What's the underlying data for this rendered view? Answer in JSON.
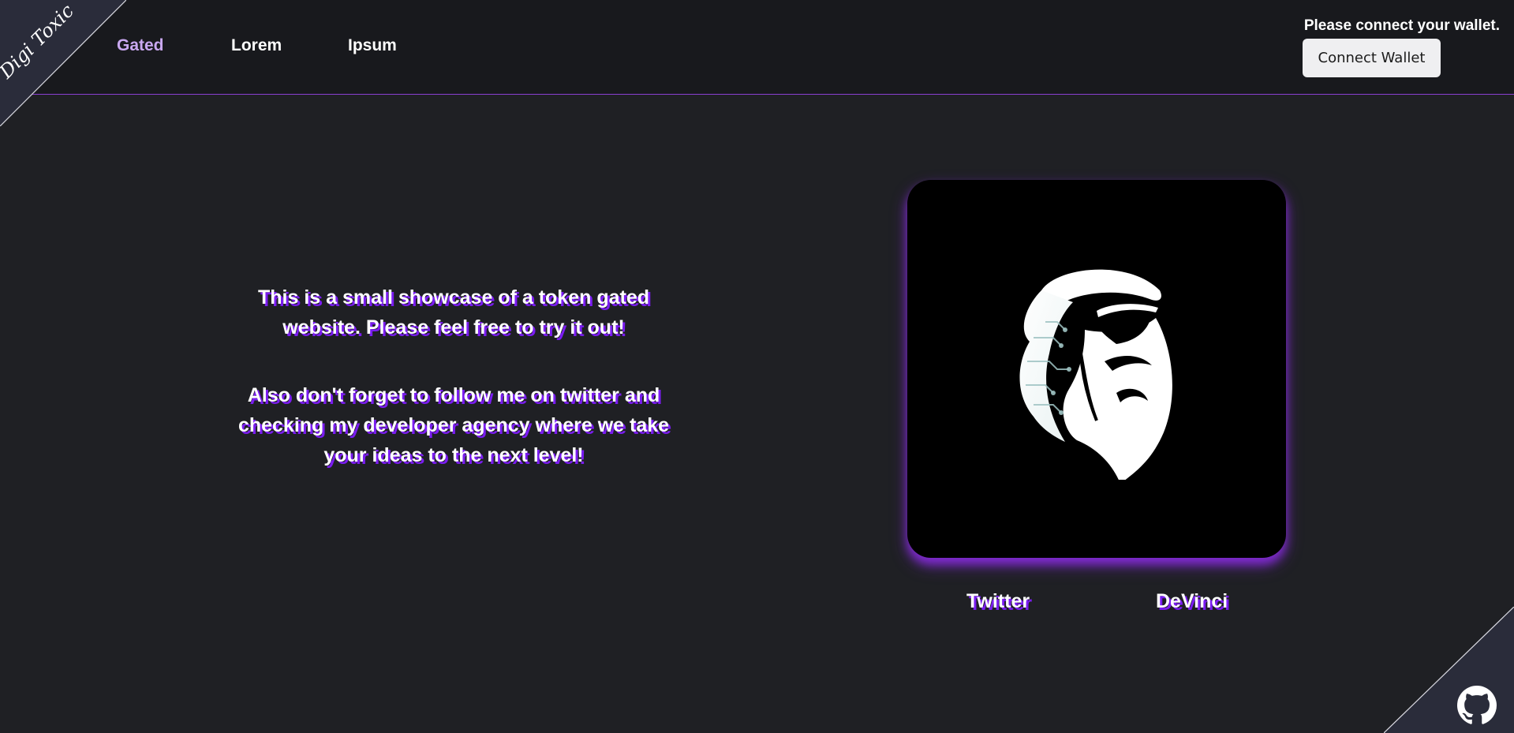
{
  "brand": {
    "logo_text": "Digi Toxic"
  },
  "nav": {
    "items": [
      {
        "label": "Gated",
        "active": true
      },
      {
        "label": "Lorem",
        "active": false
      },
      {
        "label": "Ipsum",
        "active": false
      }
    ]
  },
  "wallet": {
    "status_text": "Please connect your wallet.",
    "button_label": "Connect Wallet"
  },
  "intro": {
    "paragraph_1": "This is a small showcase of a token gated website. Please feel free to try it out!",
    "paragraph_2": "Also don't forget to follow me on twitter and checking my developer agency where we take your ideas to the next level!"
  },
  "card": {
    "image_icon": "bearded-warrior-logo-icon",
    "links": [
      {
        "label": "Twitter"
      },
      {
        "label": "DeVinci"
      }
    ]
  },
  "footer": {
    "github_icon": "github-icon"
  },
  "colors": {
    "background": "#1f2024",
    "header_bg": "#18191d",
    "accent_purple": "#8a3fd1",
    "text_shadow_purple": "#7a1cf0",
    "active_nav": "#c9a8f0",
    "corner_bg": "#2a2c3a"
  }
}
